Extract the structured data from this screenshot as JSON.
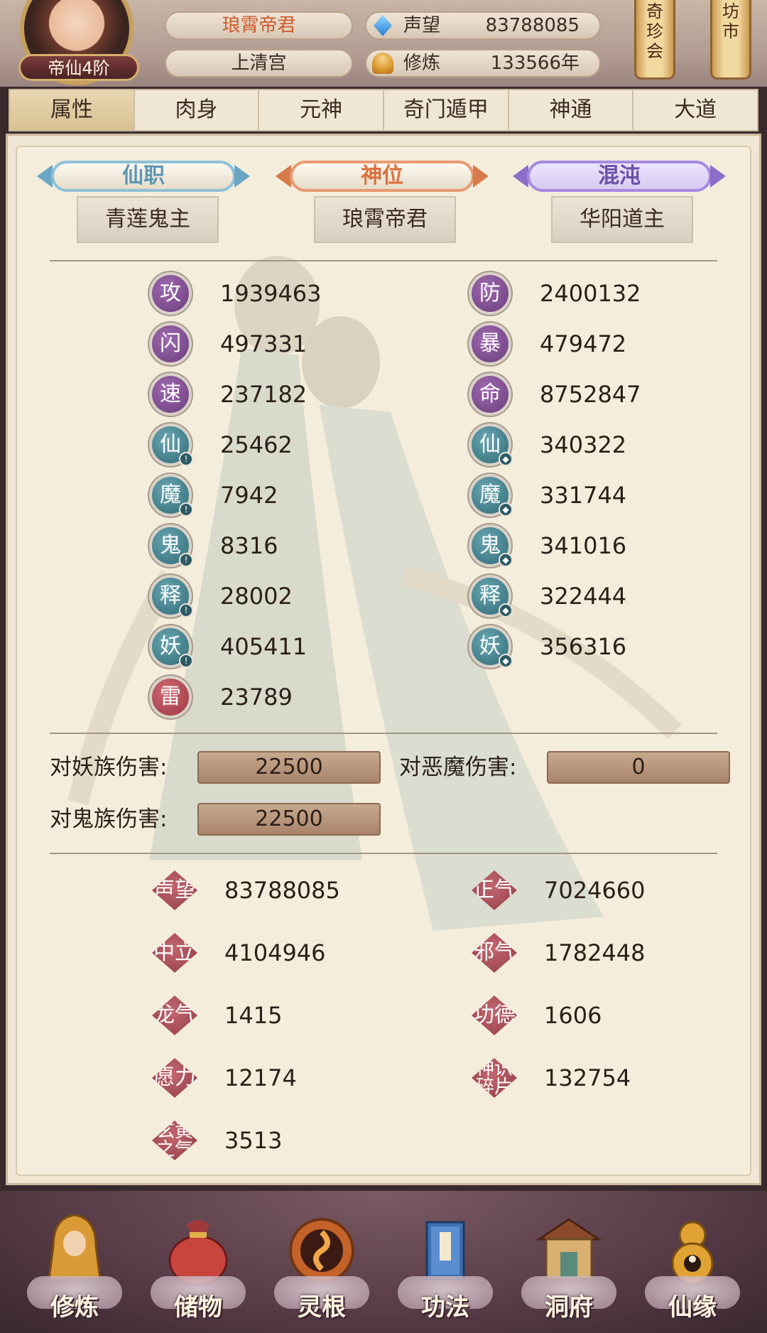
{
  "header": {
    "rank_label": "帝仙4阶",
    "player_name": "琅霄帝君",
    "sect": "上清宫",
    "stats": [
      {
        "icon": "crystal-gem-icon",
        "label": "声望",
        "value": "83788085"
      },
      {
        "icon": "meditation-icon",
        "label": "修炼",
        "value": "133566年"
      }
    ],
    "scrolls": [
      {
        "label_lines": [
          "奇",
          "珍",
          "会"
        ]
      },
      {
        "label_lines": [
          "坊",
          "市"
        ]
      }
    ]
  },
  "tabs": [
    "属性",
    "肉身",
    "元神",
    "奇门遁甲",
    "神通",
    "大道"
  ],
  "active_tab": "属性",
  "titles": [
    {
      "badge": "仙职",
      "value": "青莲鬼主",
      "color": "#6aa6c3"
    },
    {
      "badge": "神位",
      "value": "琅霄帝君",
      "color": "#d97a4a"
    },
    {
      "badge": "混沌",
      "value": "华阳道主",
      "color": "#8b6ec9"
    }
  ],
  "attributes": {
    "left": [
      {
        "icon": "攻",
        "value": "1939463",
        "style": "purple"
      },
      {
        "icon": "闪",
        "value": "497331",
        "style": "purple"
      },
      {
        "icon": "速",
        "value": "237182",
        "style": "purple"
      },
      {
        "icon": "仙",
        "value": "25462",
        "style": "teal",
        "mark": "attack"
      },
      {
        "icon": "魔",
        "value": "7942",
        "style": "teal",
        "mark": "attack"
      },
      {
        "icon": "鬼",
        "value": "8316",
        "style": "teal",
        "mark": "attack"
      },
      {
        "icon": "释",
        "value": "28002",
        "style": "teal",
        "mark": "attack"
      },
      {
        "icon": "妖",
        "value": "405411",
        "style": "teal",
        "mark": "attack"
      },
      {
        "icon": "雷",
        "value": "23789",
        "style": "red"
      }
    ],
    "right": [
      {
        "icon": "防",
        "value": "2400132",
        "style": "purple"
      },
      {
        "icon": "暴",
        "value": "479472",
        "style": "purple"
      },
      {
        "icon": "命",
        "value": "8752847",
        "style": "purple"
      },
      {
        "icon": "仙",
        "value": "340322",
        "style": "teal",
        "mark": "defense"
      },
      {
        "icon": "魔",
        "value": "331744",
        "style": "teal",
        "mark": "defense"
      },
      {
        "icon": "鬼",
        "value": "341016",
        "style": "teal",
        "mark": "defense"
      },
      {
        "icon": "释",
        "value": "322444",
        "style": "teal",
        "mark": "defense"
      },
      {
        "icon": "妖",
        "value": "356316",
        "style": "teal",
        "mark": "defense"
      }
    ]
  },
  "damage": [
    {
      "label": "对妖族伤害:",
      "value": "22500"
    },
    {
      "label": "对恶魔伤害:",
      "value": "0"
    },
    {
      "label": "对鬼族伤害:",
      "value": "22500"
    }
  ],
  "reputation": {
    "left": [
      {
        "label_lines": [
          "声望"
        ],
        "value": "83788085"
      },
      {
        "label_lines": [
          "中立"
        ],
        "value": "4104946"
      },
      {
        "label_lines": [
          "龙气"
        ],
        "value": "1415"
      },
      {
        "label_lines": [
          "愿力"
        ],
        "value": "12174"
      },
      {
        "label_lines": [
          "玄黄",
          "之气"
        ],
        "value": "3513"
      }
    ],
    "right": [
      {
        "label_lines": [
          "正气"
        ],
        "value": "7024660"
      },
      {
        "label_lines": [
          "邪气"
        ],
        "value": "1782448"
      },
      {
        "label_lines": [
          "功德"
        ],
        "value": "1606"
      },
      {
        "label_lines": [
          "神识",
          "碎片"
        ],
        "value": "132754"
      }
    ]
  },
  "bottom_nav": [
    {
      "label": "修炼",
      "icon": "cultivation-icon"
    },
    {
      "label": "储物",
      "icon": "storage-bag-icon"
    },
    {
      "label": "灵根",
      "icon": "spirit-root-icon"
    },
    {
      "label": "功法",
      "icon": "technique-book-icon"
    },
    {
      "label": "洞府",
      "icon": "cave-mansion-icon"
    },
    {
      "label": "仙缘",
      "icon": "gourd-icon"
    }
  ],
  "colors": {
    "purple_icon": "#6a3d7c",
    "teal_icon": "#2f6a76",
    "red_icon": "#9a3640",
    "name_text": "#cc5a2a"
  }
}
